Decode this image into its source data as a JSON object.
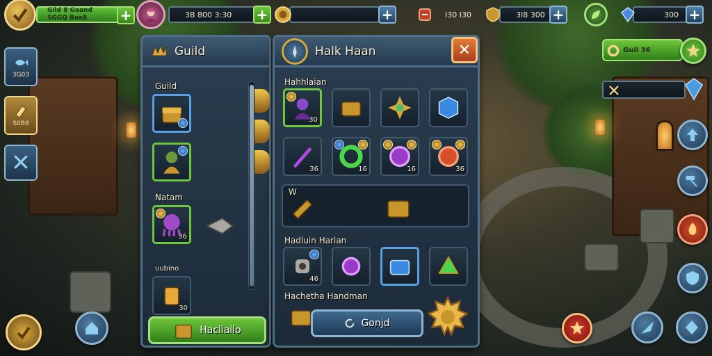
{
  "topbar": {
    "player": {
      "level_text": "Gild 8 Gaand",
      "sub_text": "SGGQ Baa8"
    },
    "res1": {
      "value": "3B 800 3:30"
    },
    "res2": {
      "value": ""
    },
    "res3": {
      "value": "Ι30 Ι30"
    },
    "res4": {
      "value": "3Ι8 300"
    },
    "res5": {
      "value": "300"
    }
  },
  "right_hud": {
    "quest": {
      "label": "Guil 36"
    },
    "bar2": {
      "label": ""
    }
  },
  "left_rail": [
    {
      "label": "3G03",
      "icon": "fish-icon"
    },
    {
      "label": "S0B8",
      "icon": "scroll-icon"
    },
    {
      "label": "",
      "icon": "crossed-swords-icon"
    }
  ],
  "guild_panel": {
    "title": "Guild",
    "section1": "Guild",
    "section2": "Natam",
    "section3": "uubino",
    "items": [
      {
        "icon": "chest-icon",
        "count": ""
      },
      {
        "icon": "warrior-icon",
        "count": ""
      },
      {
        "icon": "octopus-icon",
        "count": "36"
      },
      {
        "icon": "lantern-icon",
        "count": "30"
      }
    ],
    "action_button": "Hacliallo"
  },
  "hall_panel": {
    "title": "Halk Haan",
    "section1": "Hahhlaian",
    "section2": "W",
    "section3": "Hadluin Harian",
    "section4": "Hachetha Handman",
    "row1": [
      {
        "icon": "purple-hero-icon",
        "count": "30"
      },
      {
        "icon": "treasure-box-icon",
        "count": ""
      },
      {
        "icon": "crystal-star-icon",
        "count": ""
      },
      {
        "icon": "blue-cube-icon",
        "count": ""
      }
    ],
    "row2": [
      {
        "icon": "purple-crystal-icon",
        "count": "36"
      },
      {
        "icon": "green-swirl-icon",
        "count": "16"
      },
      {
        "icon": "purple-gear-icon",
        "count": "16"
      },
      {
        "icon": "red-orb-icon",
        "count": "36"
      }
    ],
    "row4": [
      {
        "icon": "robot-icon",
        "count": "46"
      },
      {
        "icon": "purple-orb-icon",
        "count": ""
      },
      {
        "icon": "blue-chest-icon",
        "count": ""
      },
      {
        "icon": "green-gem-icon",
        "count": ""
      }
    ],
    "action_button": "Gonjd"
  },
  "colors": {
    "panel_border": "#4f6f88",
    "accent_green": "#6ec63a",
    "accent_gold": "#f0d68a"
  }
}
